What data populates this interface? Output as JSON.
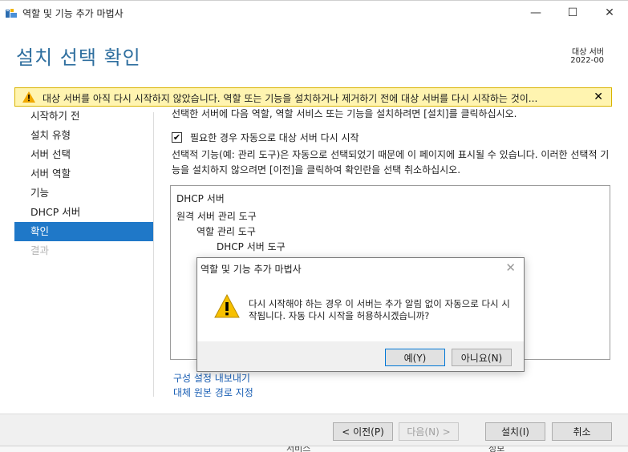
{
  "window": {
    "title": "역할 및 기능 추가 마법사",
    "minimize": "—",
    "maximize": "☐",
    "close": "✕"
  },
  "header": {
    "page_title": "설치 선택 확인",
    "dest_label": "대상 서버",
    "dest_value": "2022-00"
  },
  "warning": {
    "text": "대상 서버를 아직 다시 시작하지 않았습니다. 역할 또는 기능을 설치하거나 제거하기 전에 대상 서버를 다시 시작하는 것이...",
    "close": "✕",
    "icon": "warning-icon",
    "color": "#fff4b0"
  },
  "sidebar": {
    "items": [
      {
        "label": "시작하기 전"
      },
      {
        "label": "설치 유형"
      },
      {
        "label": "서버 선택"
      },
      {
        "label": "서버 역할"
      },
      {
        "label": "기능"
      },
      {
        "label": "DHCP 서버"
      },
      {
        "label": "확인"
      },
      {
        "label": "결과"
      }
    ],
    "active_color": "#1f78c8"
  },
  "main": {
    "intro": "선택한 서버에 다음 역할, 역할 서비스 또는 기능을 설치하려면 [설치]를 클릭하십시오.",
    "restart_checked": "✔",
    "restart_label": "필요한 경우 자동으로 대상 서버 다시 시작",
    "optional_text": "선택적 기능(예: 관리 도구)은 자동으로 선택되었기 때문에 이 페이지에 표시될 수 있습니다. 이러한 선택적 기능을 설치하지 않으려면 [이전]을 클릭하여 확인란을 선택 취소하십시오.",
    "features": [
      {
        "label": "DHCP 서버"
      },
      {
        "label": "원격 서버 관리 도구"
      },
      {
        "label": "역할 관리 도구"
      },
      {
        "label": "DHCP 서버 도구"
      }
    ],
    "links": {
      "export": "구성 설정 내보내기",
      "alternate_source": "대체 원본 경로 지정"
    }
  },
  "footer": {
    "prev": "< 이전(P)",
    "next": "다음(N) >",
    "install": "설치(I)",
    "cancel": "취소",
    "strip_left": "서비스",
    "strip_right": "정보"
  },
  "dialog": {
    "title": "역할 및 기능 추가 마법사",
    "close": "✕",
    "message": "다시 시작해야 하는 경우 이 서버는 추가 알림 없이 자동으로 다시 시작됩니다. 자동 다시 시작을 허용하시겠습니까?",
    "yes": "예(Y)",
    "no": "아니요(N)",
    "icon": "warning-icon"
  }
}
